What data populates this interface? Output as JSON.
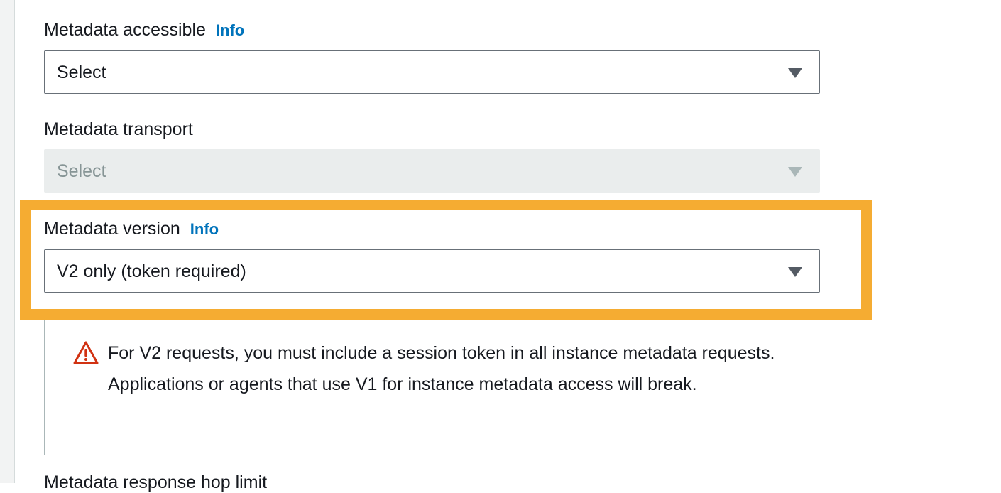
{
  "fields": {
    "metadata_accessible": {
      "label": "Metadata accessible",
      "info": "Info",
      "value": "Select"
    },
    "metadata_transport": {
      "label": "Metadata transport",
      "value": "Select",
      "disabled": true
    },
    "metadata_version": {
      "label": "Metadata version",
      "info": "Info",
      "value": "V2 only (token required)"
    },
    "next_field_cut": {
      "label": "Metadata response hop limit"
    }
  },
  "alert": {
    "type": "warning",
    "icon": "warning-triangle-icon",
    "text": "For V2 requests, you must include a session token in all instance metadata requests. Applications or agents that use V1 for instance metadata access will break."
  },
  "colors": {
    "highlight": "#f5ac32",
    "info_link": "#0073bb",
    "warning": "#d13212",
    "disabled_bg": "#eaeded"
  }
}
